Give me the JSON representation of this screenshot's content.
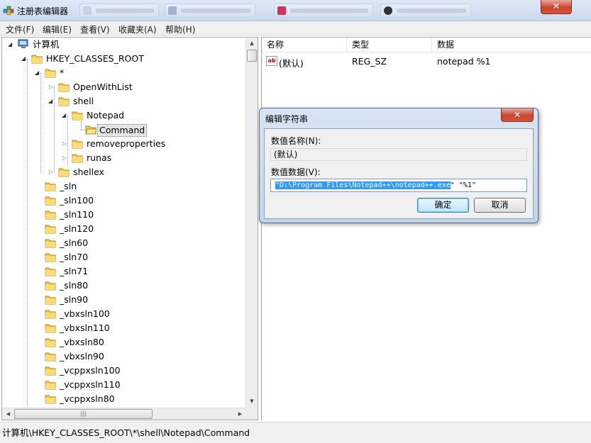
{
  "window": {
    "title": "注册表编辑器",
    "close_glyph": "✕"
  },
  "menu": [
    {
      "label": "文件(F)"
    },
    {
      "label": "编辑(E)"
    },
    {
      "label": "查看(V)"
    },
    {
      "label": "收藏夹(A)"
    },
    {
      "label": "帮助(H)"
    }
  ],
  "tree": {
    "computer": "计算机",
    "root": "HKEY_CLASSES_ROOT",
    "star": "*",
    "openwithlist": "OpenWithList",
    "shell": "shell",
    "notepad": "Notepad",
    "command": "Command",
    "removeproperties": "removeproperties",
    "runas": "runas",
    "shellex": "shellex",
    "siblings": [
      "_sln",
      "_sln100",
      "_sln110",
      "_sln120",
      "_sln60",
      "_sln70",
      "_sln71",
      "_sln80",
      "_sln90",
      "_vbxsln100",
      "_vbxsln110",
      "_vbxsln80",
      "_vbxsln90",
      "_vcppxsln100",
      "_vcppxsln110",
      "_vcppxsln80"
    ]
  },
  "list": {
    "columns": [
      "名称",
      "类型",
      "数据"
    ],
    "rows": [
      {
        "name": "(默认)",
        "type": "REG_SZ",
        "data": "notepad %1"
      }
    ]
  },
  "status": {
    "path": "计算机\\HKEY_CLASSES_ROOT\\*\\shell\\Notepad\\Command"
  },
  "dialog": {
    "title": "编辑字符串",
    "close_glyph": "✕",
    "name_label": "数值名称(N):",
    "name_value": "(默认)",
    "data_label": "数值数据(V):",
    "data_selected": "\"D:\\Program Files\\Notepad++\\notepad++.exe",
    "data_rest": "\" \"%1\"",
    "ok_label": "确定",
    "cancel_label": "取消"
  },
  "colors": {
    "selection": "#3399ff",
    "close_button": "#c7442e"
  }
}
